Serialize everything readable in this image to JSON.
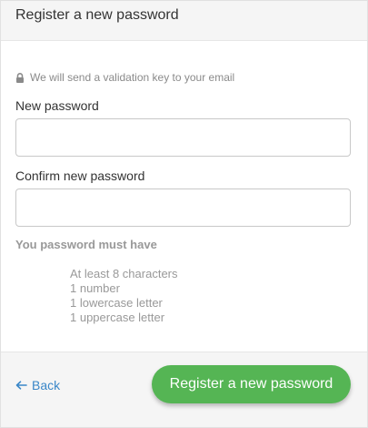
{
  "header": {
    "title": "Register a new password"
  },
  "info": {
    "text": "We will send a validation key to your email",
    "icon": "lock-icon"
  },
  "form": {
    "new_password_label": "New password",
    "new_password_value": "",
    "confirm_password_label": "Confirm new password",
    "confirm_password_value": ""
  },
  "rules": {
    "title": "You password must have",
    "items": [
      "At least 8 characters",
      "1 number",
      "1 lowercase letter",
      "1 uppercase letter"
    ]
  },
  "footer": {
    "back_label": "Back",
    "back_icon": "arrow-left-icon",
    "submit_label": "Register a new password"
  },
  "colors": {
    "accent_green": "#55b554",
    "link_blue": "#3a87c8",
    "muted_text": "#999999"
  }
}
